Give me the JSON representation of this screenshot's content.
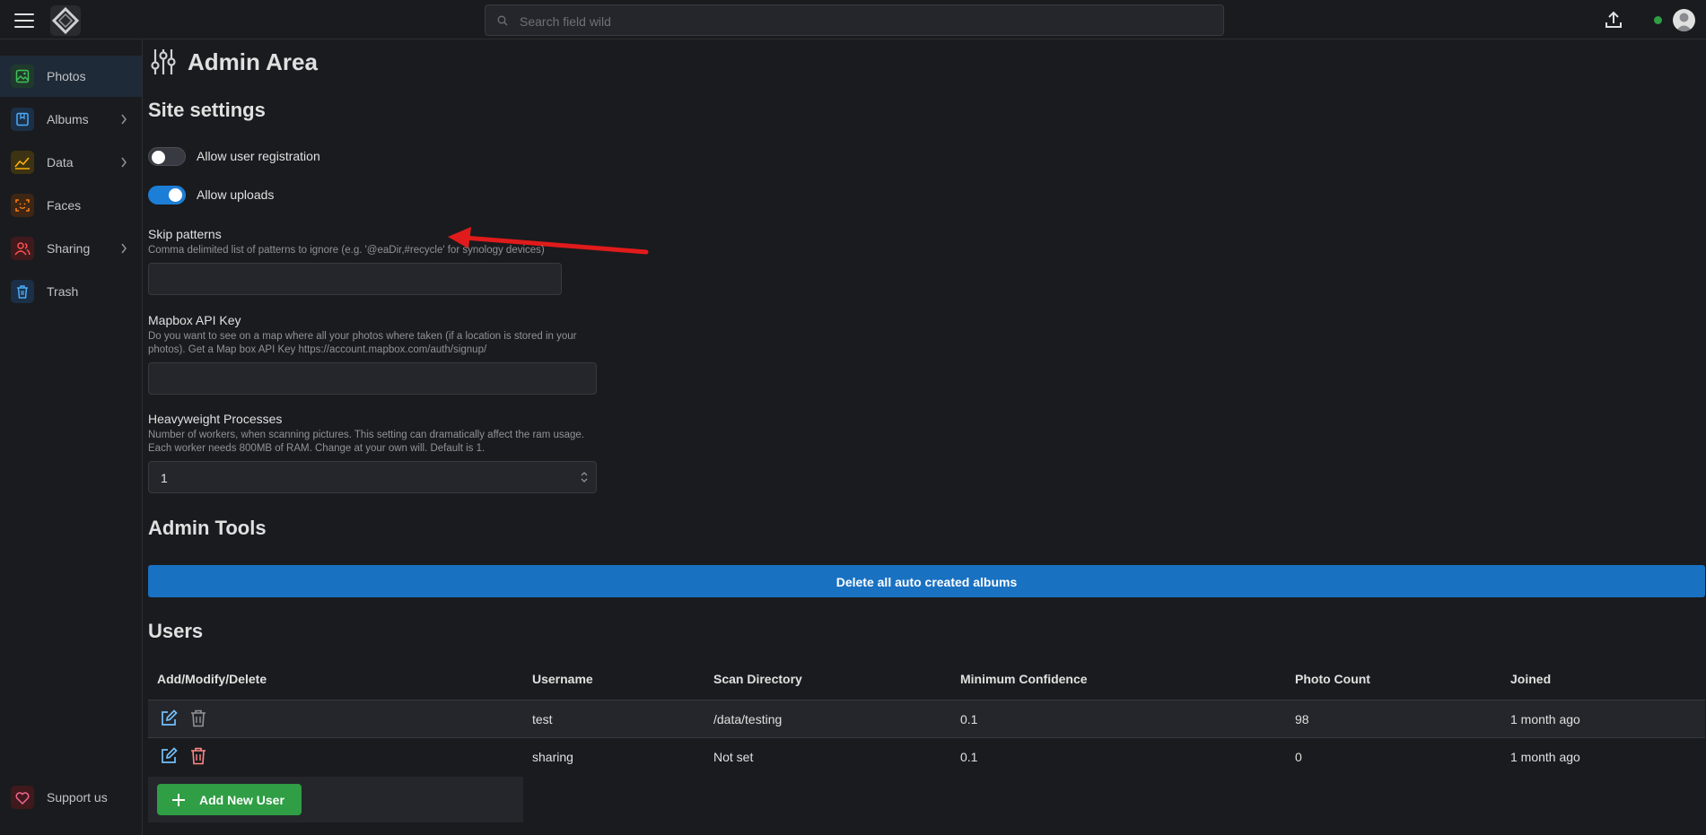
{
  "header": {
    "search_placeholder": "Search field wild"
  },
  "sidebar": {
    "items": [
      {
        "label": "Photos",
        "icon": "photo-icon",
        "color": "#40c057"
      },
      {
        "label": "Albums",
        "icon": "album-icon",
        "color": "#4dabf7"
      },
      {
        "label": "Data",
        "icon": "chart-icon",
        "color": "#fab005"
      },
      {
        "label": "Faces",
        "icon": "face-icon",
        "color": "#fd7e14"
      },
      {
        "label": "Sharing",
        "icon": "users-icon",
        "color": "#fa5252"
      },
      {
        "label": "Trash",
        "icon": "trash-icon",
        "color": "#4dabf7"
      }
    ],
    "support_label": "Support us"
  },
  "page": {
    "title": "Admin Area"
  },
  "site_settings": {
    "heading": "Site settings",
    "allow_registration_label": "Allow user registration",
    "allow_registration": false,
    "allow_uploads_label": "Allow uploads",
    "allow_uploads": true,
    "skip_patterns": {
      "label": "Skip patterns",
      "description": "Comma delimited list of patterns to ignore (e.g. '@eaDir,#recycle' for synology devices)",
      "value": ""
    },
    "mapbox": {
      "label": "Mapbox API Key",
      "description": "Do you want to see on a map where all your photos where taken (if a location is stored in your photos). Get a Map box API Key https://account.mapbox.com/auth/signup/",
      "value": ""
    },
    "heavyweight": {
      "label": "Heavyweight Processes",
      "description": "Number of workers, when scanning pictures. This setting can dramatically affect the ram usage. Each worker needs 800MB of RAM. Change at your own will. Default is 1.",
      "value": "1"
    }
  },
  "admin_tools": {
    "heading": "Admin Tools",
    "delete_albums_label": "Delete all auto created albums"
  },
  "users": {
    "heading": "Users",
    "columns": [
      "Add/Modify/Delete",
      "Username",
      "Scan Directory",
      "Minimum Confidence",
      "Photo Count",
      "Joined"
    ],
    "rows": [
      {
        "username": "test",
        "scan_directory": "/data/testing",
        "min_confidence": "0.1",
        "photo_count": "98",
        "joined": "1 month ago"
      },
      {
        "username": "sharing",
        "scan_directory": "Not set",
        "min_confidence": "0.1",
        "photo_count": "0",
        "joined": "1 month ago"
      }
    ],
    "add_label": "Add New User"
  },
  "colors": {
    "accent": "#1c7ed6",
    "success": "#2f9e44",
    "danger": "#fa5252",
    "annotation": "#e01b1b"
  }
}
